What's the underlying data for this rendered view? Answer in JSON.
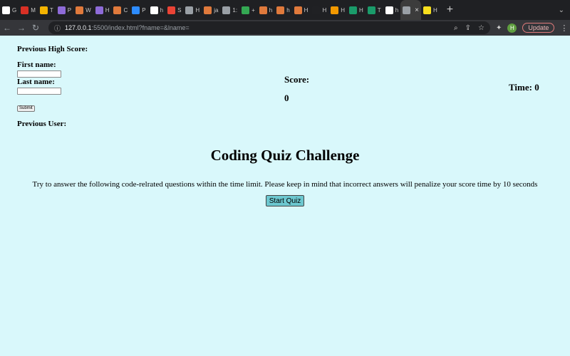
{
  "browser": {
    "tabs": [
      {
        "icon": "github-icon",
        "label": "G",
        "color": "#ffffff"
      },
      {
        "icon": "mail-icon",
        "label": "M",
        "color": "#d93025"
      },
      {
        "icon": "smiley-icon",
        "label": "T",
        "color": "#f4b400"
      },
      {
        "icon": "h-icon",
        "label": "P",
        "color": "#8e6bd8"
      },
      {
        "icon": "triangle-icon",
        "label": "W",
        "color": "#e07a3c"
      },
      {
        "icon": "h-icon",
        "label": "H",
        "color": "#8e6bd8"
      },
      {
        "icon": "triangle-icon",
        "label": "C",
        "color": "#e07a3c"
      },
      {
        "icon": "zoom-icon",
        "label": "P",
        "color": "#2d8cff"
      },
      {
        "icon": "google-icon",
        "label": "h",
        "color": "#ffffff"
      },
      {
        "icon": "gmail-icon",
        "label": "S",
        "color": "#ea4335"
      },
      {
        "icon": "globe-icon",
        "label": "H",
        "color": "#9aa0a6"
      },
      {
        "icon": "triangle-icon",
        "label": "ja",
        "color": "#e07a3c"
      },
      {
        "icon": "globe-icon",
        "label": "1:",
        "color": "#9aa0a6"
      },
      {
        "icon": "grid-icon",
        "label": "+",
        "color": "#34a853"
      },
      {
        "icon": "triangle-icon",
        "label": "h",
        "color": "#e07a3c"
      },
      {
        "icon": "triangle-icon",
        "label": "h",
        "color": "#e07a3c"
      },
      {
        "icon": "triangle-icon",
        "label": "H",
        "color": "#e07a3c"
      },
      {
        "icon": "bracket-icon",
        "label": "H",
        "color": "#202124"
      },
      {
        "icon": "hexagon-icon",
        "label": "H",
        "color": "#f29900"
      },
      {
        "icon": "w-icon",
        "label": "H",
        "color": "#1a9b6a"
      },
      {
        "icon": "w-icon",
        "label": "T",
        "color": "#1a9b6a"
      },
      {
        "icon": "chrome-icon",
        "label": "h",
        "color": "#ffffff"
      },
      {
        "icon": "globe-icon",
        "label": "",
        "color": "#9aa0a6"
      },
      {
        "icon": "js-icon",
        "label": "H",
        "color": "#f7df1e"
      }
    ],
    "url_host": "127.0.0.1",
    "url_path": ":5500/index.html?fname=&lname=",
    "update_label": "Update",
    "profile_initial": "H"
  },
  "page": {
    "previous_high_score_label": "Previous High Score:",
    "first_name_label": "First name:",
    "last_name_label": "Last name:",
    "first_name_value": "",
    "last_name_value": "",
    "submit_label": "Submit",
    "previous_user_label": "Previous User:",
    "score_label": "Score:",
    "score_value": "0",
    "time_text": "Time: 0",
    "title": "Coding Quiz Challenge",
    "instructions": "Try to answer the following code-relrated questions within the time limit. Please keep in mind that incorrect answers will penalize your score time by 10 seconds",
    "start_button": "Start Quiz"
  },
  "colors": {
    "page_background": "#d9f8fb",
    "start_button": "#6cc7cf"
  }
}
